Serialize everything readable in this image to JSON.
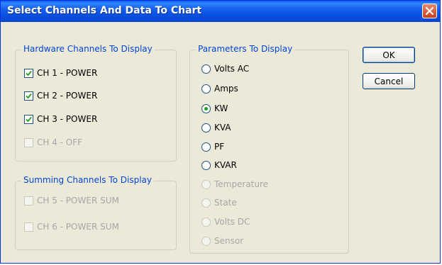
{
  "window": {
    "title": "Select Channels And Data To Chart"
  },
  "hardware_group": {
    "label": "Hardware Channels To Display",
    "items": [
      {
        "label": "CH 1 - POWER",
        "checked": true,
        "enabled": true
      },
      {
        "label": "CH 2 - POWER",
        "checked": true,
        "enabled": true
      },
      {
        "label": "CH 3 - POWER",
        "checked": true,
        "enabled": true
      },
      {
        "label": "CH 4 - OFF",
        "checked": false,
        "enabled": false
      }
    ]
  },
  "summing_group": {
    "label": "Summing Channels To Display",
    "items": [
      {
        "label": "CH 5 - POWER SUM",
        "checked": false,
        "enabled": false
      },
      {
        "label": "CH 6 - POWER SUM",
        "checked": false,
        "enabled": false
      }
    ]
  },
  "parameters_group": {
    "label": "Parameters To Display",
    "items": [
      {
        "label": "Volts AC",
        "selected": false,
        "enabled": true
      },
      {
        "label": "Amps",
        "selected": false,
        "enabled": true
      },
      {
        "label": "KW",
        "selected": true,
        "enabled": true
      },
      {
        "label": "KVA",
        "selected": false,
        "enabled": true
      },
      {
        "label": "PF",
        "selected": false,
        "enabled": true
      },
      {
        "label": "KVAR",
        "selected": false,
        "enabled": true
      },
      {
        "label": "Temperature",
        "selected": false,
        "enabled": false
      },
      {
        "label": "State",
        "selected": false,
        "enabled": false
      },
      {
        "label": "Volts DC",
        "selected": false,
        "enabled": false
      },
      {
        "label": "Sensor",
        "selected": false,
        "enabled": false
      }
    ]
  },
  "buttons": {
    "ok": "OK",
    "cancel": "Cancel"
  }
}
